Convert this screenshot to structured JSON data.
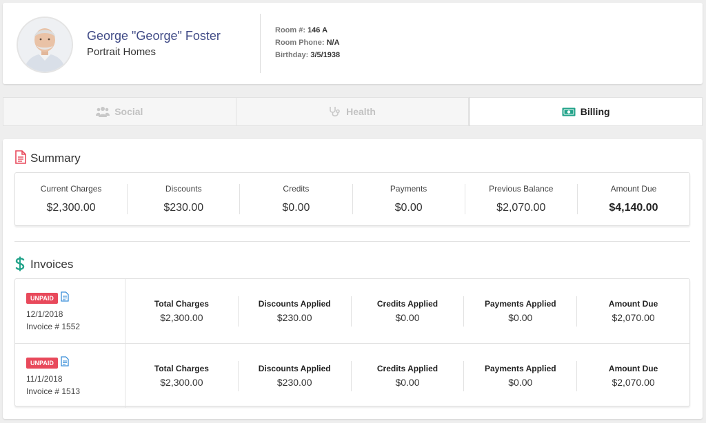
{
  "profile": {
    "name": "George \"George\" Foster",
    "facility": "Portrait Homes",
    "room_label": "Room #:",
    "room_value": "146 A",
    "phone_label": "Room Phone:",
    "phone_value": "N/A",
    "birthday_label": "Birthday:",
    "birthday_value": "3/5/1938"
  },
  "tabs": [
    {
      "label": "Social",
      "icon": "users-icon",
      "active": false
    },
    {
      "label": "Health",
      "icon": "stethoscope-icon",
      "active": false
    },
    {
      "label": "Billing",
      "icon": "money-icon",
      "active": true
    }
  ],
  "summary": {
    "title": "Summary",
    "icon": "document-icon",
    "columns": [
      {
        "label": "Current Charges",
        "value": "$2,300.00"
      },
      {
        "label": "Discounts",
        "value": "$230.00"
      },
      {
        "label": "Credits",
        "value": "$0.00"
      },
      {
        "label": "Payments",
        "value": "$0.00"
      },
      {
        "label": "Previous Balance",
        "value": "$2,070.00"
      },
      {
        "label": "Amount Due",
        "value": "$4,140.00"
      }
    ]
  },
  "invoices": {
    "title": "Invoices",
    "icon": "dollar-icon",
    "column_labels": [
      "Total Charges",
      "Discounts Applied",
      "Credits Applied",
      "Payments Applied",
      "Amount Due"
    ],
    "rows": [
      {
        "status": "UNPAID",
        "date": "12/1/2018",
        "number": "Invoice # 1552",
        "values": [
          "$2,300.00",
          "$230.00",
          "$0.00",
          "$0.00",
          "$2,070.00"
        ]
      },
      {
        "status": "UNPAID",
        "date": "11/1/2018",
        "number": "Invoice # 1513",
        "values": [
          "$2,300.00",
          "$230.00",
          "$0.00",
          "$0.00",
          "$2,070.00"
        ]
      }
    ]
  },
  "colors": {
    "name": "#3f4a86",
    "status_unpaid": "#e8495b",
    "summary_icon": "#e8495b",
    "invoice_icon": "#22a38a",
    "doc_icon": "#3b8fd9",
    "billing_icon": "#22a38a"
  }
}
